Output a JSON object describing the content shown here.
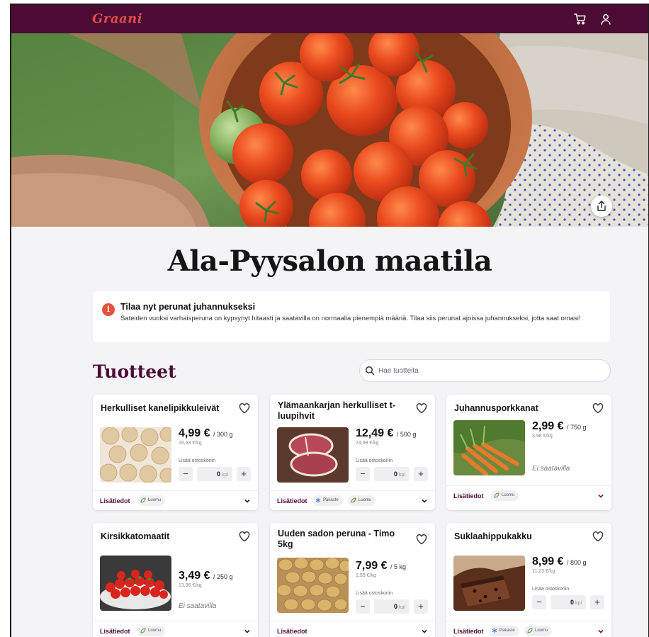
{
  "app": {
    "brand": "Graani",
    "cart_icon": "shopping-cart-icon",
    "account_icon": "user-icon",
    "share_icon": "share-icon"
  },
  "farm": {
    "name": "Ala-Pyysalon maatila"
  },
  "notice": {
    "icon": "i",
    "title": "Tilaa nyt perunat juhannukseksi",
    "text": "Sateiden vuoksi varhaisperuna on kypsynyt hitaasti ja saatavilla on normaalia pienempiä määriä. Tilaa siis perunat ajoissa juhannukseksi, jotta saat omasi!"
  },
  "products_section": {
    "title": "Tuotteet",
    "search_placeholder": "Hae tuotteita"
  },
  "labels": {
    "add_to_cart": "Lisää ostoskoriin",
    "unavailable": "Ei saatavilla",
    "more_info": "Lisätiedot",
    "unit_kpl": "kpl",
    "minus": "−",
    "plus": "+"
  },
  "colors": {
    "brand_dark": "#4d0b34",
    "brand_accent": "#e64d4a",
    "notice_icon": "#e4533d"
  },
  "products": [
    {
      "name": "Herkulliset kanelipikkuleivät",
      "price": "4,99 €",
      "unit": "/ 300 g",
      "per_kg": "16,63 €/kg",
      "available": true,
      "quantity": "0",
      "tags": [
        "Luomu"
      ]
    },
    {
      "name": "Ylämaankarjan herkulliset t-luupihvit",
      "price": "12,49 €",
      "unit": "/ 500 g",
      "per_kg": "24,98 €/kg",
      "available": true,
      "quantity": "0",
      "tags": [
        "Pakaste",
        "Luomu"
      ]
    },
    {
      "name": "Juhannusporkkanat",
      "price": "2,99 €",
      "unit": "/ 750 g",
      "per_kg": "3,98 €/kg",
      "available": false,
      "tags": [
        "Luomu"
      ]
    },
    {
      "name": "Kirsikkatomaatit",
      "price": "3,49 €",
      "unit": "/ 250 g",
      "per_kg": "13,96 €/kg",
      "available": false,
      "tags": [
        "Luomu"
      ]
    },
    {
      "name": "Uuden sadon peruna - Timo 5kg",
      "price": "7,99 €",
      "unit": "/ 5 kg",
      "per_kg": "1,59 €/kg",
      "available": true,
      "quantity": "0",
      "tags": []
    },
    {
      "name": "Suklaahippukakku",
      "price": "8,99 €",
      "unit": "/ 800 g",
      "per_kg": "11,23 €/kg",
      "available": true,
      "quantity": "0",
      "tags": [
        "Pakaste",
        "Luomu"
      ]
    }
  ]
}
